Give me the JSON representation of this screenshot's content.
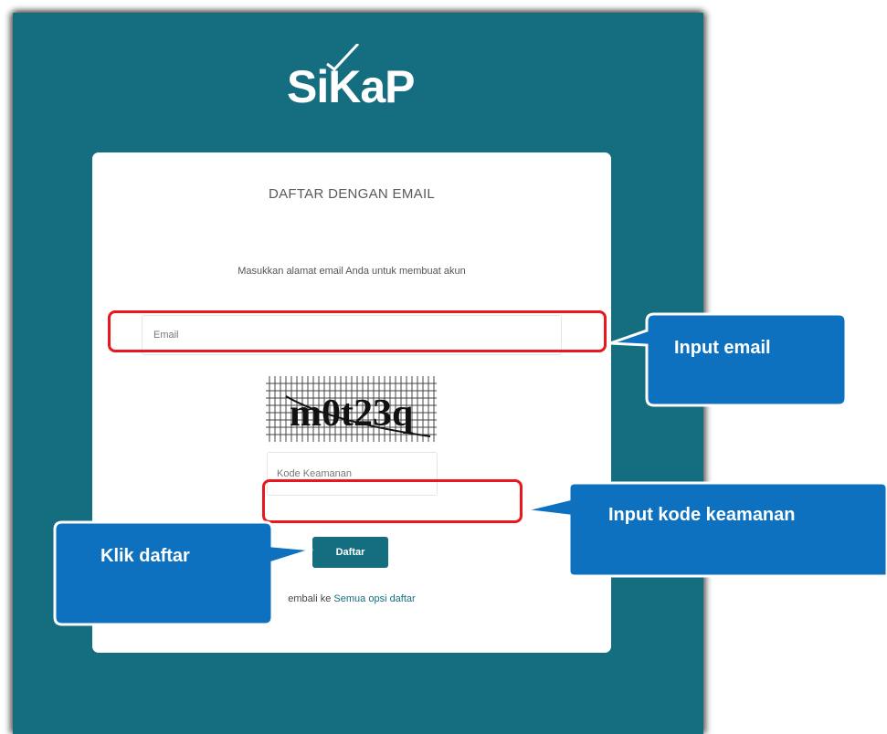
{
  "brand": {
    "logo_text": "SiKaP"
  },
  "form": {
    "title": "DAFTAR DENGAN EMAIL",
    "subtitle": "Masukkan alamat email Anda untuk membuat akun",
    "email_placeholder": "Email",
    "captcha_text": "m0t23q",
    "code_placeholder": "Kode Keamanan",
    "submit_label": "Daftar",
    "back_prefix": "embali ke ",
    "back_link": "Semua opsi daftar"
  },
  "annotations": {
    "input_email": "Input email",
    "input_code": "Input kode keamanan",
    "click_daftar": "Klik daftar"
  },
  "colors": {
    "primary": "#146e7f",
    "callout": "#0e71c0",
    "highlight": "#e8181e"
  }
}
